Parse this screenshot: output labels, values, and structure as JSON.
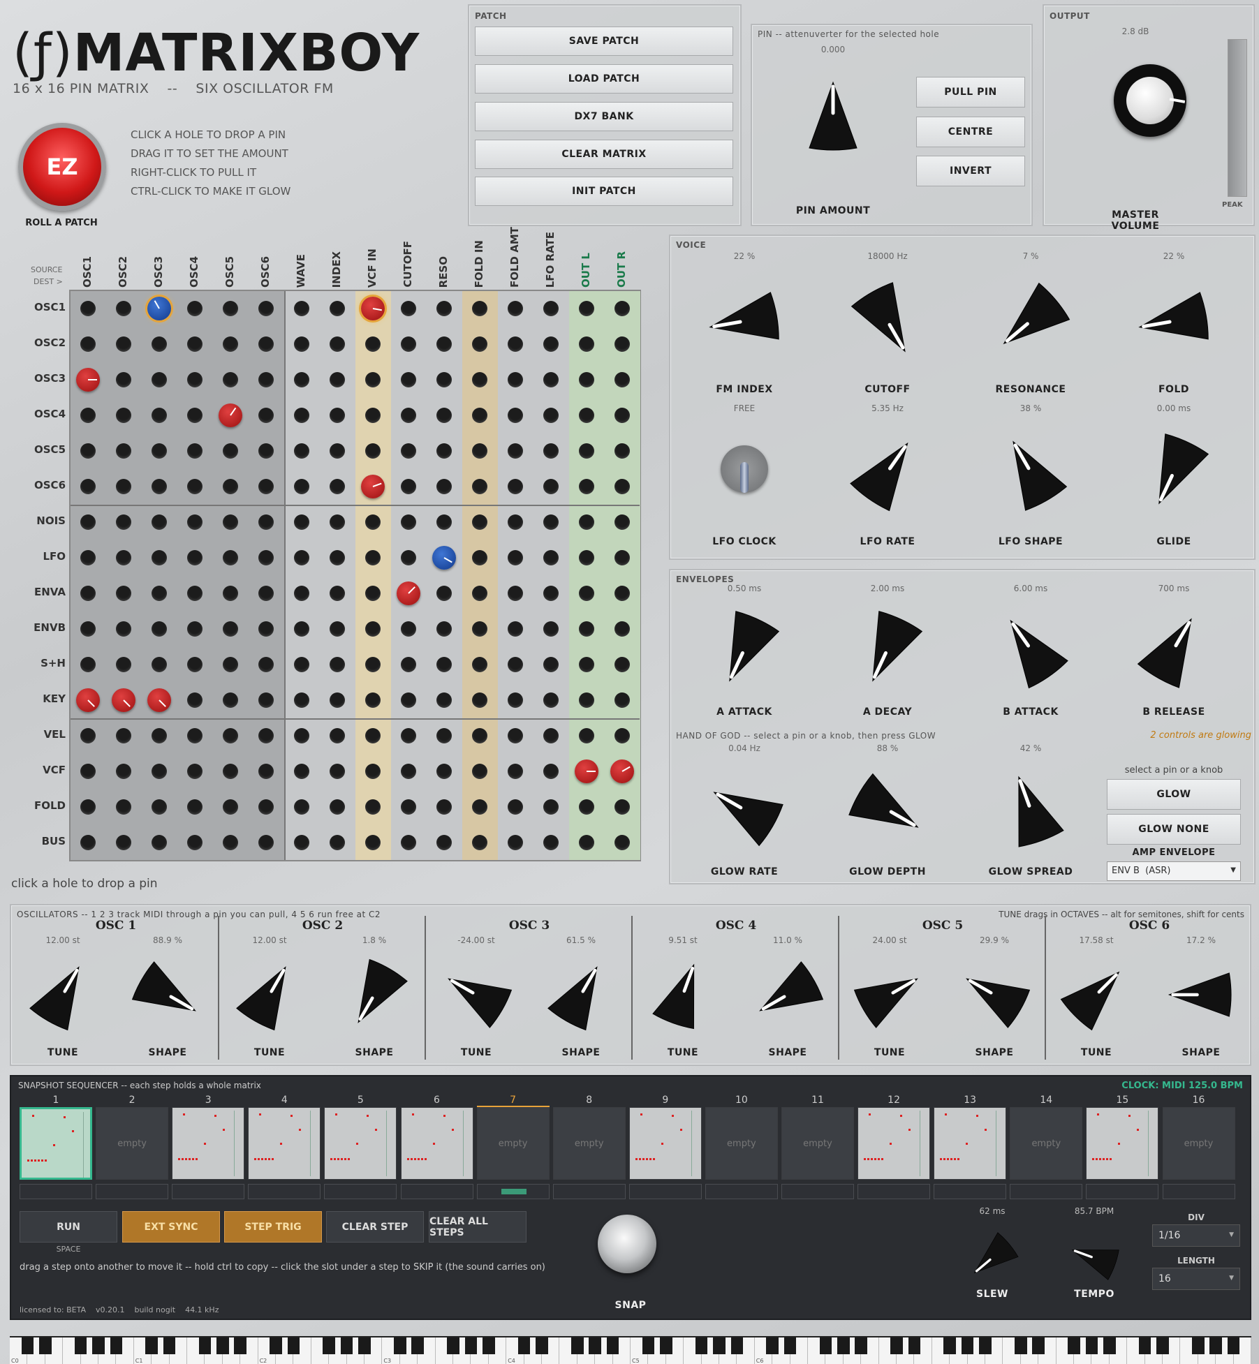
{
  "header": {
    "logo_prefix": "(ƒ)",
    "logo_name": "MATRIXBOY",
    "subtitle": "16 x 16 PIN MATRIX    --    SIX OSCILLATOR FM",
    "ez_label": "EZ",
    "roll_label": "ROLL A PATCH",
    "instructions": [
      "CLICK A HOLE TO DROP A PIN",
      "DRAG IT TO SET THE AMOUNT",
      "RIGHT-CLICK TO PULL IT",
      "CTRL-CLICK TO MAKE IT GLOW"
    ]
  },
  "patch": {
    "title": "PATCH",
    "buttons": [
      "SAVE PATCH",
      "LOAD PATCH",
      "DX7 BANK",
      "CLEAR MATRIX",
      "INIT PATCH"
    ]
  },
  "pin": {
    "title": "PIN  --  attenuverter for the selected hole",
    "value": "0.000",
    "label": "PIN AMOUNT",
    "buttons": [
      "PULL PIN",
      "CENTRE",
      "INVERT"
    ]
  },
  "output": {
    "title": "OUTPUT",
    "value": "2.8 dB",
    "label": "MASTER VOLUME",
    "peak": "PEAK"
  },
  "matrix": {
    "source_label": "SOURCE",
    "dest_label": "DEST >",
    "columns": [
      "OSC1",
      "OSC2",
      "OSC3",
      "OSC4",
      "OSC5",
      "OSC6",
      "WAVE",
      "INDEX",
      "VCF IN",
      "CUTOFF",
      "RESO",
      "FOLD IN",
      "FOLD AMT",
      "LFO RATE",
      "OUT L",
      "OUT R"
    ],
    "rows": [
      "OSC1",
      "OSC2",
      "OSC3",
      "OSC4",
      "OSC5",
      "OSC6",
      "NOIS",
      "LFO",
      "ENVA",
      "ENVB",
      "S+H",
      "KEY",
      "VEL",
      "VCF",
      "FOLD",
      "BUS"
    ],
    "pins": [
      {
        "r": 0,
        "c": 2,
        "color": "blue",
        "a": -30,
        "sel": true
      },
      {
        "r": 0,
        "c": 8,
        "color": "red",
        "a": 100,
        "sel": true
      },
      {
        "r": 2,
        "c": 0,
        "color": "red",
        "a": 90
      },
      {
        "r": 3,
        "c": 4,
        "color": "red",
        "a": 35
      },
      {
        "r": 5,
        "c": 8,
        "color": "red",
        "a": 70
      },
      {
        "r": 7,
        "c": 10,
        "color": "blue",
        "a": 120
      },
      {
        "r": 8,
        "c": 9,
        "color": "red",
        "a": 45
      },
      {
        "r": 11,
        "c": 0,
        "color": "red",
        "a": 135
      },
      {
        "r": 11,
        "c": 1,
        "color": "red",
        "a": 135
      },
      {
        "r": 11,
        "c": 2,
        "color": "red",
        "a": 135
      },
      {
        "r": 13,
        "c": 14,
        "color": "red",
        "a": 90
      },
      {
        "r": 13,
        "c": 15,
        "color": "red",
        "a": 60
      }
    ],
    "status": "click a hole to drop a pin"
  },
  "voice": {
    "title": "VOICE",
    "knobs": [
      {
        "label": "FM INDEX",
        "value": "22 %",
        "a": -100
      },
      {
        "label": "CUTOFF",
        "value": "18000 Hz",
        "a": 150
      },
      {
        "label": "RESONANCE",
        "value": "7 %",
        "a": -130
      },
      {
        "label": "FOLD",
        "value": "22 %",
        "a": -100
      },
      {
        "label": "LFO CLOCK",
        "value": "FREE",
        "switch": true
      },
      {
        "label": "LFO RATE",
        "value": "5.35 Hz",
        "a": 35
      },
      {
        "label": "LFO SHAPE",
        "value": "38 %",
        "a": -30
      },
      {
        "label": "GLIDE",
        "value": "0.00 ms",
        "a": -155
      }
    ]
  },
  "envelopes": {
    "title": "ENVELOPES",
    "knobs": [
      {
        "label": "A  ATTACK",
        "value": "0.50 ms",
        "a": -155
      },
      {
        "label": "A  DECAY",
        "value": "2.00 ms",
        "a": -155
      },
      {
        "label": "B  ATTACK",
        "value": "6.00 ms",
        "a": -35
      },
      {
        "label": "B  RELEASE",
        "value": "700 ms",
        "a": 30
      }
    ]
  },
  "hog": {
    "title": "HAND OF GOD  --  select a pin or a knob, then press GLOW",
    "status": "2 controls are glowing",
    "knobs": [
      {
        "label": "GLOW RATE",
        "value": "0.04 Hz",
        "a": -60
      },
      {
        "label": "GLOW DEPTH",
        "value": "88 %",
        "a": 120
      },
      {
        "label": "GLOW SPREAD",
        "value": "42 %",
        "a": -20
      }
    ],
    "hint": "select a pin or a knob",
    "buttons": [
      "GLOW",
      "GLOW NONE"
    ],
    "amp_label": "AMP ENVELOPE",
    "amp_value": "ENV B  (ASR)"
  },
  "oscillators": {
    "title": "OSCILLATORS  --  1 2 3 track MIDI through a pin you can pull,  4 5 6 run free at C2",
    "hint": "TUNE drags in OCTAVES  --  alt for semitones, shift for cents",
    "units": [
      {
        "name": "OSC 1",
        "tune": "12.00 st",
        "ta": 30,
        "shape": "88.9 %",
        "sa": 120
      },
      {
        "name": "OSC 2",
        "tune": "12.00 st",
        "ta": 30,
        "shape": "1.8 %",
        "sa": -150
      },
      {
        "name": "OSC 3",
        "tune": "-24.00 st",
        "ta": -60,
        "shape": "61.5 %",
        "sa": 30
      },
      {
        "name": "OSC 4",
        "tune": "9.51 st",
        "ta": 20,
        "shape": "11.0 %",
        "sa": -120
      },
      {
        "name": "OSC 5",
        "tune": "24.00 st",
        "ta": 60,
        "shape": "29.9 %",
        "sa": -60
      },
      {
        "name": "OSC 6",
        "tune": "17.58 st",
        "ta": 45,
        "shape": "17.2 %",
        "sa": -90
      }
    ],
    "tune_label": "TUNE",
    "shape_label": "SHAPE"
  },
  "sequencer": {
    "title": "SNAPSHOT SEQUENCER  --  each step holds a whole matrix",
    "clock": "CLOCK: MIDI  125.0 BPM",
    "steps": [
      "1",
      "2",
      "3",
      "4",
      "5",
      "6",
      "7",
      "8",
      "9",
      "10",
      "11",
      "12",
      "13",
      "14",
      "15",
      "16"
    ],
    "filled": [
      1,
      0,
      1,
      1,
      1,
      1,
      0,
      0,
      1,
      0,
      0,
      1,
      1,
      0,
      1,
      0
    ],
    "empty_label": "empty",
    "current": 7,
    "buttons": [
      "RUN",
      "EXT SYNC",
      "STEP TRIG",
      "CLEAR STEP",
      "CLEAR ALL STEPS"
    ],
    "space": "SPACE",
    "hint": "drag a step onto another to move it  --  hold ctrl to copy  --  click the slot under a step to SKIP it (the sound carries on)",
    "snap": "SNAP",
    "slew_value": "62 ms",
    "slew": "SLEW",
    "tempo_value": "85.7 BPM",
    "tempo": "TEMPO",
    "div_label": "DIV",
    "div_value": "1/16",
    "length_label": "LENGTH",
    "length_value": "16"
  },
  "footer": {
    "license": "licensed to: BETA    v0.20.1    build nogit    44.1 kHz"
  },
  "keyboard": {
    "octaves": [
      "C0",
      "C1",
      "C2",
      "C3",
      "C4",
      "C5",
      "C6"
    ]
  }
}
